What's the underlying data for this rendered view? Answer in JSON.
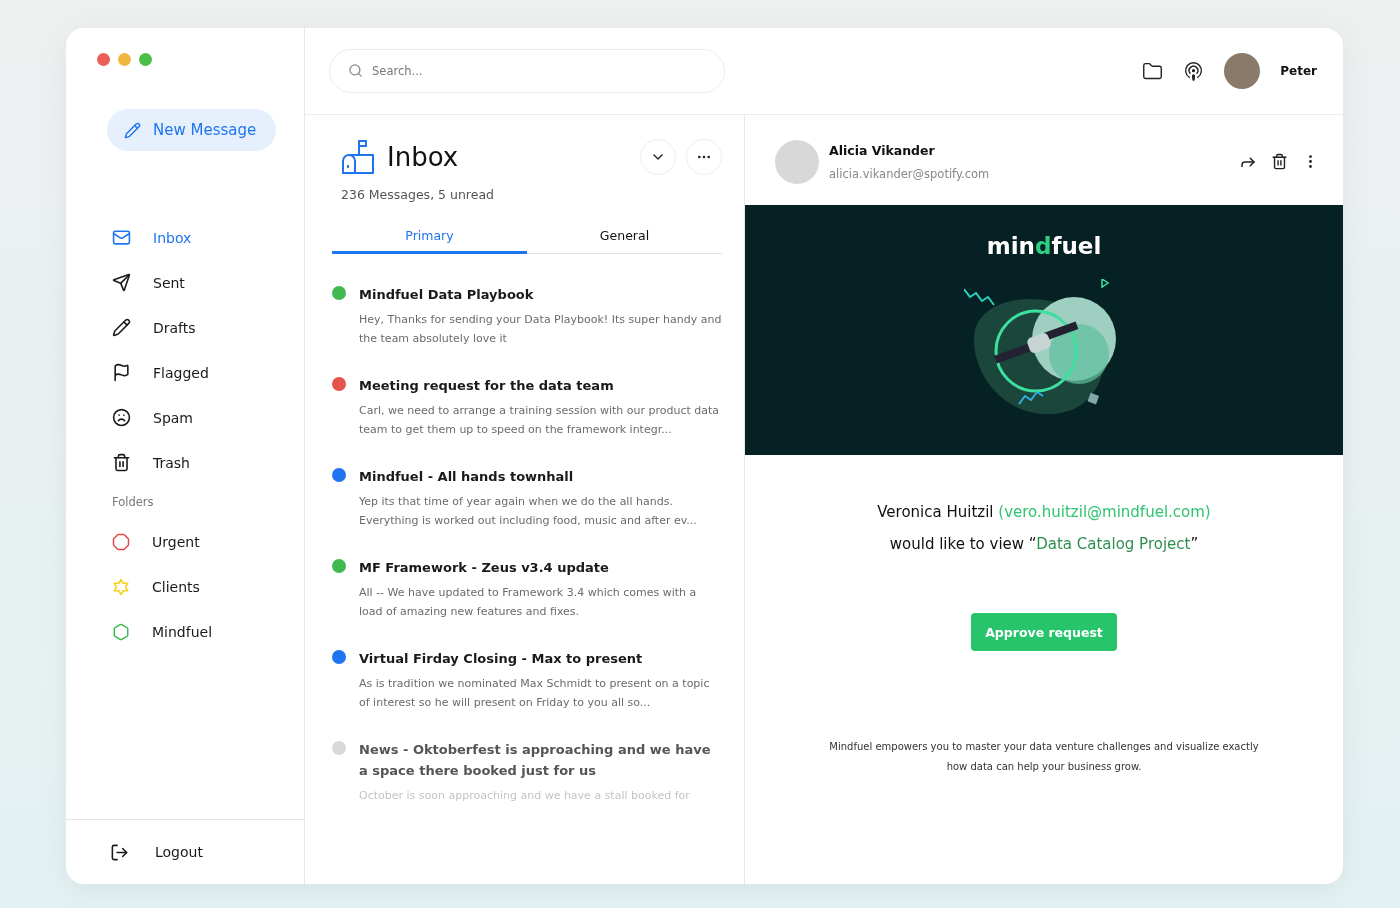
{
  "sidebar": {
    "new_message": "New Message",
    "nav": [
      {
        "kind": "inbox",
        "label": "Inbox",
        "selected": true
      },
      {
        "kind": "sent",
        "label": "Sent",
        "selected": false
      },
      {
        "kind": "drafts",
        "label": "Drafts",
        "selected": false
      },
      {
        "kind": "flagged",
        "label": "Flagged",
        "selected": false
      },
      {
        "kind": "spam",
        "label": "Spam",
        "selected": false
      },
      {
        "kind": "trash",
        "label": "Trash",
        "selected": false
      }
    ],
    "folders_heading": "Folders",
    "folders": [
      {
        "kind": "octagon",
        "label": "Urgent",
        "color": "#e5484d"
      },
      {
        "kind": "star",
        "label": "Clients",
        "color": "#f5d21f"
      },
      {
        "kind": "hexagon",
        "label": "Mindfuel",
        "color": "#3fb950"
      }
    ],
    "logout": "Logout"
  },
  "topbar": {
    "search": {
      "placeholder": "Search..."
    },
    "user": "Peter"
  },
  "mailbox": {
    "title": "Inbox",
    "summary": "236 Messages, 5 unread",
    "tabs": [
      {
        "label": "Primary",
        "selected": true
      },
      {
        "label": "General",
        "selected": false
      }
    ],
    "messages": [
      {
        "title": "Mindfuel Data Playbook",
        "preview": "Hey, Thanks for sending your Data Playbook! Its super handy and the team absolutely love it",
        "color": "#3fb950",
        "read": false
      },
      {
        "title": "Meeting request for the data team",
        "preview": "Carl, we need to arrange a training session with our product data team to get them up to speed on the framework integr...",
        "color": "#e5534b",
        "read": false
      },
      {
        "title": "Mindfuel - All hands townhall",
        "preview": "Yep its that time of year again when we do the all hands. Everything is worked out including food, music and after ev...",
        "color": "#1f75f0",
        "read": false
      },
      {
        "title": "MF Framework - Zeus v3.4 update",
        "preview": "All -- We have updated to Framework 3.4 which comes with a load of amazing new features and fixes.",
        "color": "#3fb950",
        "read": false
      },
      {
        "title": "Virtual Firday Closing - Max to present",
        "preview": "As is tradition we nominated Max Schmidt to present on a topic of interest so he will present on Friday to you all so...",
        "color": "#1f75f0",
        "read": false
      },
      {
        "title": "News - Oktoberfest is approaching and we have a space there booked just for us",
        "preview": "October is soon approaching and we have a stall booked for",
        "color": "#d9d9d9",
        "read": true
      }
    ]
  },
  "reader": {
    "sender": "Alicia Vikander",
    "email": "alicia.vikander@spotify.com",
    "logo": {
      "before": "min",
      "accent": "d",
      "after": "fuel"
    },
    "request": {
      "name": "Veronica Huitzil",
      "contact": "(vero.huitzil@mindfuel.com)",
      "prefix": "would like to view “",
      "project": "Data Catalog Project",
      "suffix": "”"
    },
    "approve": "Approve request",
    "footer": "Mindfuel empowers you to master your data venture challenges and visualize exactly how data can help your business grow."
  }
}
